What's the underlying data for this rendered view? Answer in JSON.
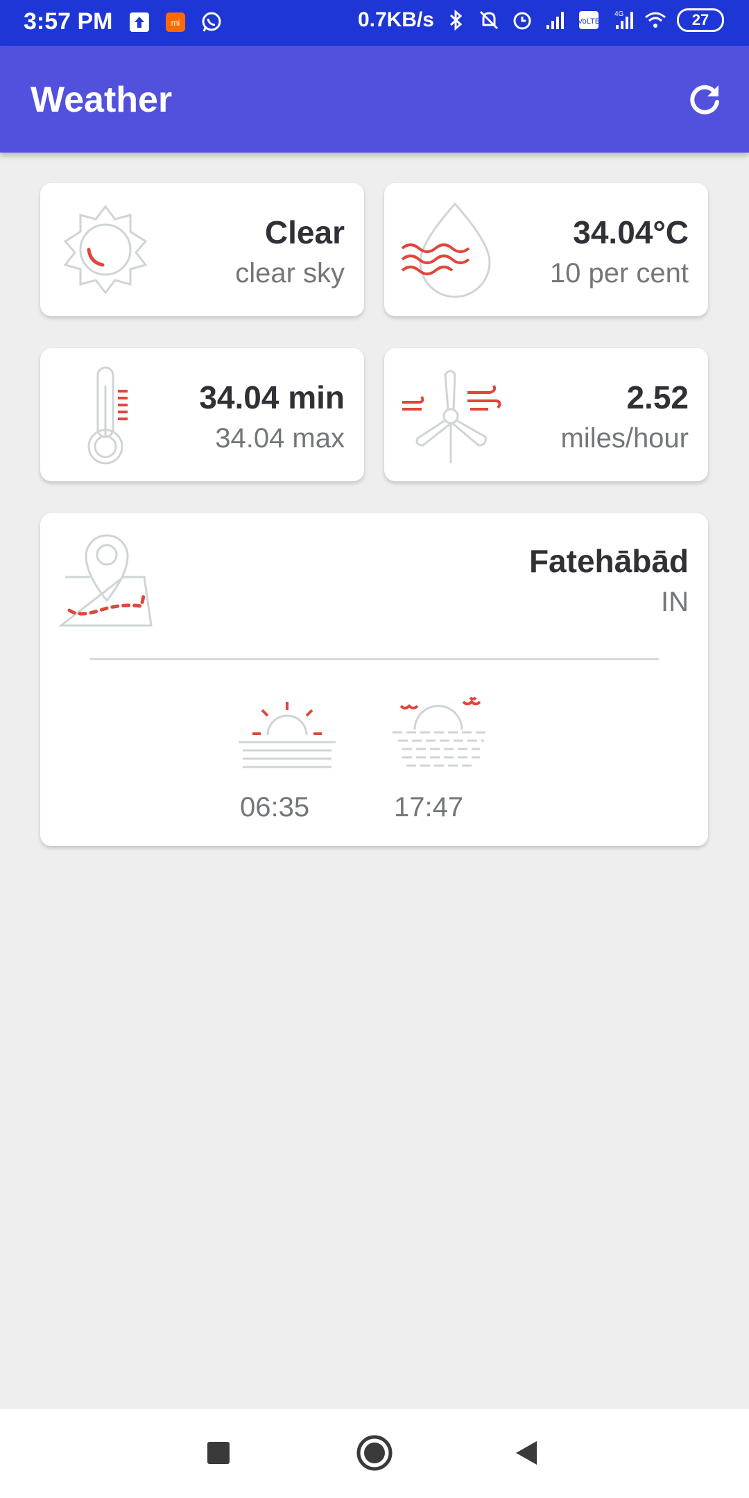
{
  "status_bar": {
    "time": "3:57 PM",
    "network_speed": "0.7KB/s",
    "network_type": "4G",
    "volte": "VoLTE",
    "battery": "27",
    "icons": [
      "upload-icon",
      "mi-icon",
      "whatsapp-icon",
      "bluetooth-icon",
      "mute-icon",
      "alarm-icon",
      "signal-icon",
      "volte-icon",
      "signal-4g-icon",
      "wifi-icon",
      "battery-icon"
    ]
  },
  "app_bar": {
    "title": "Weather",
    "refresh_icon": "refresh-icon"
  },
  "cards": {
    "condition": {
      "main": "Clear",
      "description": "clear sky",
      "icon": "sun-icon"
    },
    "humidity": {
      "main": "34.04°C",
      "sub": "10 per cent",
      "icon": "humidity-drop-icon"
    },
    "temperature": {
      "main": "34.04 min",
      "sub": "34.04 max",
      "icon": "thermometer-icon"
    },
    "wind": {
      "main": "2.52",
      "sub": "miles/hour",
      "icon": "wind-turbine-icon"
    },
    "location": {
      "city": "Fatehābād",
      "country": "IN",
      "icon": "map-pin-icon",
      "sunrise": "06:35",
      "sunset": "17:47"
    }
  },
  "nav_bar": {
    "icons": [
      "recents-icon",
      "home-icon",
      "back-icon"
    ]
  },
  "colors": {
    "status_bar": "#1f36d6",
    "app_bar": "#5151dd",
    "background": "#eeeeee",
    "accent_red": "#e0463c",
    "icon_gray": "#cfd4d6"
  }
}
